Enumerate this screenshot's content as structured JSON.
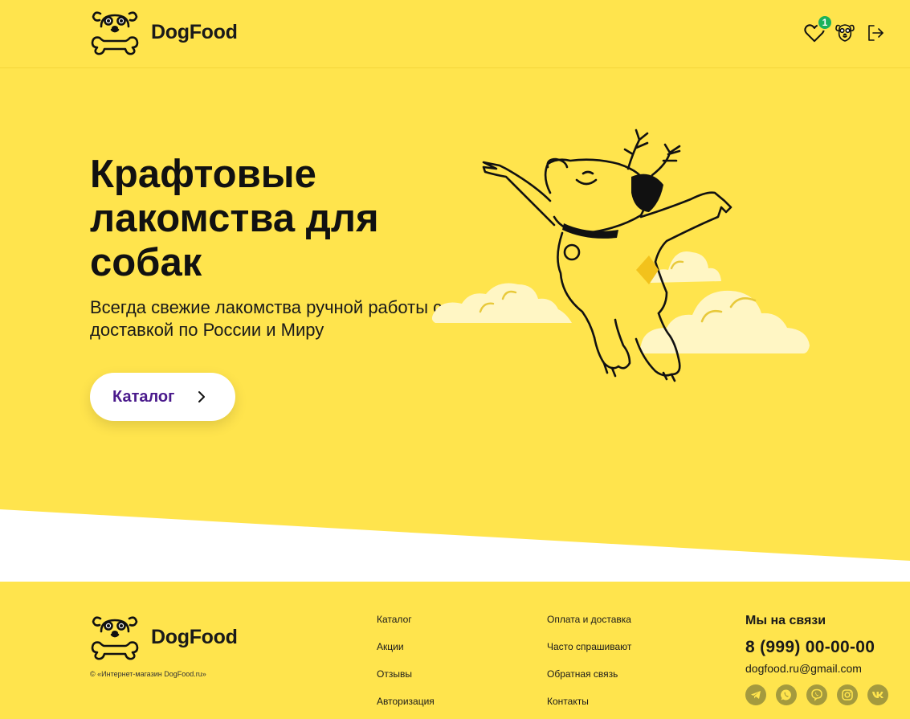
{
  "header": {
    "logo_text": "DogFood",
    "favorites_count": "1"
  },
  "hero": {
    "title": "Крафтовые лакомства для собак",
    "subtitle": "Всегда свежие лакомства ручной работы с доставкой по России и Миру",
    "catalog_button": "Каталог"
  },
  "footer": {
    "logo_text": "DogFood",
    "copyright": "© «Интернет-магазин DogFood.ru»",
    "links_col1": [
      "Каталог",
      "Акции",
      "Отзывы",
      "Авторизация"
    ],
    "links_col2": [
      "Оплата и доставка",
      "Часто спрашивают",
      "Обратная связь",
      "Контакты"
    ],
    "contacts_title": "Мы на связи",
    "phone": "8 (999) 00-00-00",
    "email": "dogfood.ru@gmail.com",
    "socials": [
      "telegram-icon",
      "whatsapp-icon",
      "viber-icon",
      "instagram-icon",
      "vk-icon"
    ]
  },
  "colors": {
    "background": "#ffe44d",
    "accent_text": "#4a1a8c",
    "badge": "#1bb25a",
    "social_bg": "#a49a3e"
  }
}
